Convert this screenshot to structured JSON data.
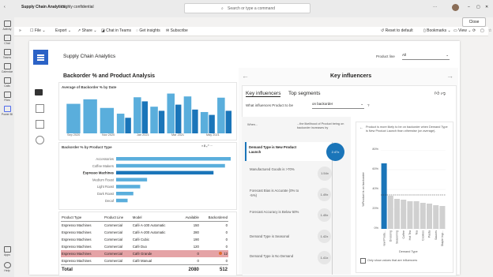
{
  "window": {
    "title": "Supply Chain Analytics",
    "sensitivity": "Highly confidential",
    "search_placeholder": "Search or type a command",
    "close_label": "Close"
  },
  "rail": {
    "items": [
      {
        "label": "Activity",
        "icon": "bell-icon"
      },
      {
        "label": "Chat",
        "icon": "chat-icon"
      },
      {
        "label": "Teams",
        "icon": "teams-icon"
      },
      {
        "label": "Calendar",
        "icon": "calendar-icon"
      },
      {
        "label": "Calls",
        "icon": "phone-icon"
      },
      {
        "label": "Files",
        "icon": "file-icon"
      },
      {
        "label": "Power BI",
        "icon": "powerbi-icon"
      },
      {
        "label": "Apps",
        "icon": "apps-icon"
      },
      {
        "label": "Help",
        "icon": "help-icon"
      }
    ]
  },
  "toolbar": {
    "file": "File",
    "export": "Export",
    "share": "Share",
    "chat": "Chat in Teams",
    "insights": "Get insights",
    "subscribe": "Subscribe",
    "reset": "Reset to default",
    "bookmarks": "Bookmarks",
    "view": "View"
  },
  "report": {
    "title": "Supply Chain Analytics",
    "filter_label": "Product line",
    "filter_value": "All"
  },
  "left_section": {
    "title": "Backorder % and Product Analysis"
  },
  "column_chart": {
    "title": "Average of Backorder % by Date",
    "xticks": [
      "Sep 2020",
      "Nov 2020",
      "Jan 2021",
      "Mar 2021",
      "May 2021"
    ]
  },
  "bar_chart": {
    "title": "Backorder % by Product Type",
    "categories": [
      "Accessories",
      "Coffee Makers",
      "Espresso Machines",
      "Medium Roast",
      "Light Roast",
      "Dark Roast",
      "Decaf"
    ]
  },
  "chart_data": [
    {
      "type": "bar",
      "title": "Average of Backorder % by Date",
      "categories": [
        "Sep 2020",
        "Oct 2020",
        "Nov 2020",
        "Dec 2020",
        "Jan 2021",
        "Feb 2021",
        "Mar 2021",
        "Apr 2021",
        "May 2021",
        "Jun 2021"
      ],
      "series": [
        {
          "values": [
            0.72,
            0.83,
            0.62,
            0.48,
            0.88,
            0.65,
            0.97,
            0.9,
            0.52,
            0.87
          ]
        },
        {
          "values": [
            0,
            0,
            0,
            0.38,
            0.78,
            0.55,
            0.7,
            0.58,
            0.45,
            0.55
          ]
        }
      ]
    },
    {
      "type": "bar",
      "title": "Backorder % by Product Type",
      "categories": [
        "Accessories",
        "Coffee Makers",
        "Espresso Machines",
        "Medium Roast",
        "Light Roast",
        "Dark Roast",
        "Decaf"
      ],
      "values": [
        1.0,
        0.95,
        0.85,
        0.27,
        0.21,
        0.15,
        0.1
      ]
    },
    {
      "type": "bar",
      "title": "",
      "categories": [
        "New Produ...",
        "Dressing",
        "Seasoning",
        "Coffee",
        "Hot Tea",
        "Tea",
        "Cookies",
        "Pasta",
        "Sauces",
        "Staple Ingr..."
      ],
      "values": [
        0.83,
        0.42,
        0.38,
        0.37,
        0.35,
        0.35,
        0.33,
        0.32,
        0.3,
        0.29
      ]
    }
  ],
  "table": {
    "headers": [
      "Product Type",
      "Product Line",
      "Model",
      "Available",
      "Backordered"
    ],
    "rows": [
      [
        "Espresso Machines",
        "Commercial",
        "Café A-100 Automatic",
        "150",
        "0"
      ],
      [
        "Espresso Machines",
        "Commercial",
        "Café A-200 Automatic",
        "280",
        "0"
      ],
      [
        "Espresso Machines",
        "Commercial",
        "Café Cubic",
        "190",
        "0"
      ],
      [
        "Espresso Machines",
        "Commercial",
        "Café Duo",
        "120",
        "0"
      ],
      [
        "Espresso Machines",
        "Commercial",
        "Café Grande",
        "0",
        "12"
      ],
      [
        "Espresso Machines",
        "Commercial",
        "Café Manual",
        "0",
        "0"
      ]
    ],
    "total_label": "Total",
    "total_available": "2080",
    "total_backordered": "512"
  },
  "key_influencers": {
    "title": "Key influencers",
    "tab1": "Key influencers",
    "tab2": "Top segments",
    "question": "What influences Product to be",
    "question_value": "on backorder",
    "when_label": "When...",
    "likelihood_label": "...the likelihood of Product being on backorder increases by",
    "items": [
      {
        "label": "Demand Type is New Product Launch",
        "value": "2.47x"
      },
      {
        "label": "Manufactured Goods is >70%",
        "value": "1.54x"
      },
      {
        "label": "Forecast Bias is Accurate (0% to -5%)",
        "value": "1.49x"
      },
      {
        "label": "Forecast Accuracy is Below 50%",
        "value": "1.45x"
      },
      {
        "label": "Demand Type is Seasonal",
        "value": "1.42x"
      },
      {
        "label": "Demand Type is No Demand",
        "value": "1.41x"
      }
    ],
    "detail_text": "Product is more likely to be on backorder when Demand Type is New Product Launch than otherwise (on average).",
    "detail_yticks": [
      "80%",
      "60%",
      "40%",
      "20%",
      "0%"
    ],
    "detail_ylabel": "%Product is on backorder",
    "detail_xlabel": "Demand Type",
    "checkbox_label": "Only show values that are influencers"
  },
  "colors": {
    "accent": "#2b62c6",
    "bar_light": "#5aaedc",
    "bar_dark": "#1a75b9",
    "highlight_row": "#e5a3a6"
  }
}
